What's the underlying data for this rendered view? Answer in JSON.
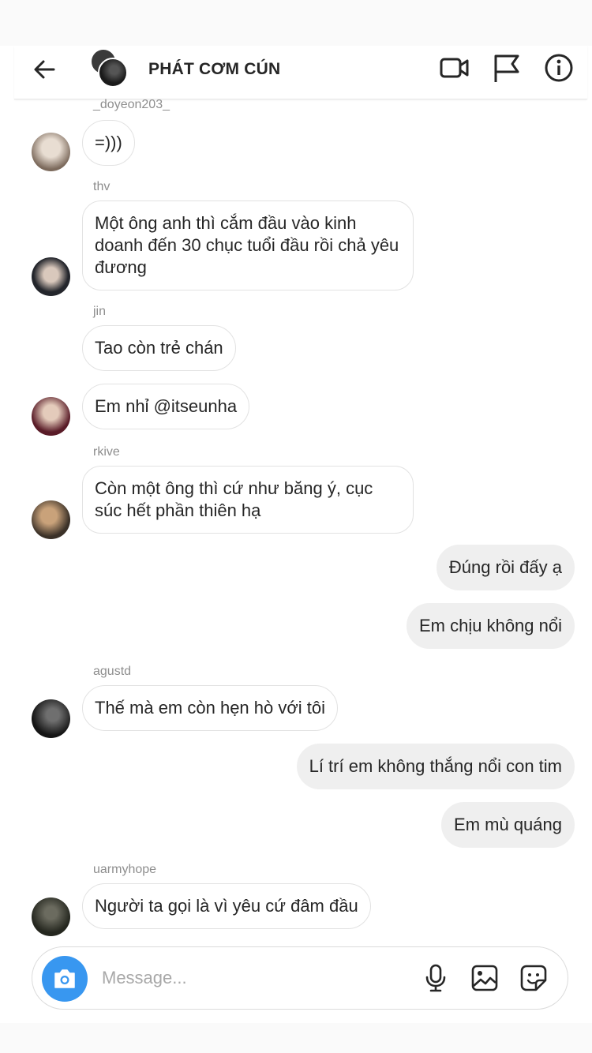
{
  "header": {
    "title": "PHÁT CƠM CÚN",
    "back_icon": "arrow-left-icon",
    "icons": [
      "video-call-icon",
      "flag-icon",
      "info-icon"
    ]
  },
  "messages": [
    {
      "sender": "_doyeon203_",
      "text": "=)))",
      "direction": "incoming"
    },
    {
      "sender": "thv",
      "text": "Một ông anh thì cắm đầu vào kinh doanh đến 30 chục tuổi đầu rồi chả yêu đương",
      "direction": "incoming"
    },
    {
      "sender": "jin",
      "text": "Tao còn trẻ chán",
      "direction": "incoming"
    },
    {
      "sender": "",
      "text": "Em nhỉ @itseunha",
      "direction": "incoming"
    },
    {
      "sender": "rkive",
      "text": "Còn một ông thì cứ như băng ý, cục súc hết phần thiên hạ",
      "direction": "incoming"
    },
    {
      "sender": "",
      "text": "Đúng rồi đấy ạ",
      "direction": "outgoing"
    },
    {
      "sender": "",
      "text": "Em chịu không nổi",
      "direction": "outgoing"
    },
    {
      "sender": "agustd",
      "text": "Thế mà em còn hẹn hò với tôi",
      "direction": "incoming"
    },
    {
      "sender": "",
      "text": "Lí trí em không thắng nổi con tim",
      "direction": "outgoing"
    },
    {
      "sender": "",
      "text": "Em mù quáng",
      "direction": "outgoing"
    },
    {
      "sender": "uarmyhope",
      "text": "Người ta gọi là vì yêu cứ đâm đầu",
      "direction": "incoming"
    }
  ],
  "composer": {
    "placeholder": "Message...",
    "accent": "#3897f0",
    "icons": [
      "camera-icon",
      "microphone-icon",
      "gallery-icon",
      "sticker-icon"
    ]
  }
}
